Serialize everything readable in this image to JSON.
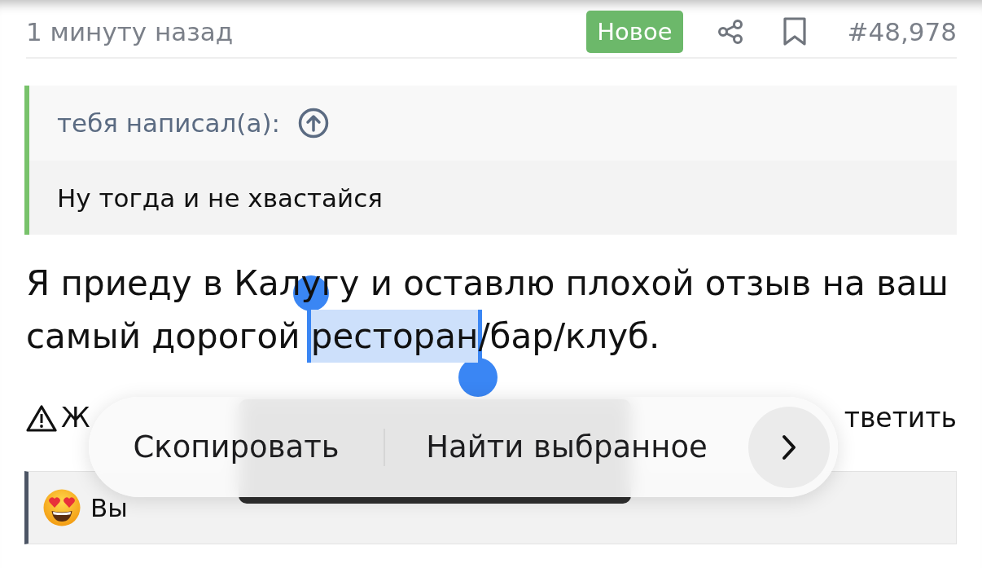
{
  "header": {
    "time": "1 минуту назад",
    "badge": "Новое",
    "post_number": "#48,978"
  },
  "quote": {
    "author_line": "тебя написал(а):",
    "text": "Ну тогда и не хвастайся"
  },
  "message": {
    "parts": [
      {
        "text": "Я приеду в Калугу и оставлю плохой отзыв на ваш самый дорогой ",
        "selected": false
      },
      {
        "text": "ресторан",
        "selected": true
      },
      {
        "text": "/бар/клуб.",
        "selected": false
      }
    ]
  },
  "actions": {
    "report": "Ж",
    "reply": "тветить"
  },
  "reaction": {
    "label": "Вы"
  },
  "context_menu": {
    "items": [
      "Скопировать",
      "Найти выбранное"
    ]
  }
}
